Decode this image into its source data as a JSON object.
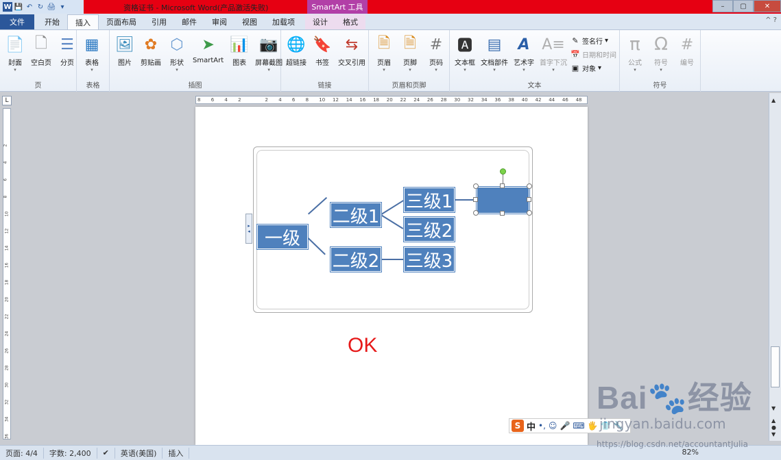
{
  "window": {
    "title": "资格证书 - Microsoft Word(产品激活失败)",
    "context_tab": "SmartArt 工具",
    "controls": {
      "minimize": "–",
      "maximize": "▢",
      "close": "✕"
    }
  },
  "quick_access": [
    "W",
    "💾",
    "↶",
    "↻",
    "🖨",
    "▾"
  ],
  "tabs": [
    {
      "label": "文件"
    },
    {
      "label": "开始"
    },
    {
      "label": "插入"
    },
    {
      "label": "页面布局"
    },
    {
      "label": "引用"
    },
    {
      "label": "邮件"
    },
    {
      "label": "审阅"
    },
    {
      "label": "视图"
    },
    {
      "label": "加载项"
    },
    {
      "label": "设计"
    },
    {
      "label": "格式"
    }
  ],
  "help": "^ ?",
  "ribbon": {
    "page_group": {
      "label": "页",
      "buttons": [
        "封面",
        "空白页",
        "分页"
      ]
    },
    "table_group": {
      "label": "表格",
      "buttons": [
        "表格"
      ]
    },
    "illust_group": {
      "label": "插图",
      "buttons": [
        "图片",
        "剪贴画",
        "形状",
        "SmartArt",
        "图表",
        "屏幕截图"
      ]
    },
    "link_group": {
      "label": "链接",
      "buttons": [
        "超链接",
        "书签",
        "交叉引用"
      ]
    },
    "hf_group": {
      "label": "页眉和页脚",
      "buttons": [
        "页眉",
        "页脚",
        "页码"
      ]
    },
    "text_group": {
      "label": "文本",
      "buttons": [
        "文本框",
        "文档部件",
        "艺术字",
        "首字下沉"
      ],
      "small": [
        "签名行",
        "日期和时间",
        "对象"
      ]
    },
    "symbol_group": {
      "label": "符号",
      "buttons": [
        "公式",
        "符号",
        "编号"
      ]
    }
  },
  "ruler_numbers": [
    "8",
    "6",
    "4",
    "2",
    "",
    "2",
    "4",
    "6",
    "8",
    "10",
    "12",
    "14",
    "16",
    "18",
    "20",
    "22",
    "24",
    "26",
    "28",
    "30",
    "32",
    "34",
    "36",
    "38",
    "40",
    "42",
    "44",
    "46",
    "48"
  ],
  "vruler_numbers": [
    "2",
    "4",
    "6",
    "8",
    "10",
    "12",
    "14",
    "16",
    "18",
    "20",
    "22",
    "24",
    "26",
    "28",
    "30",
    "32",
    "34",
    "36"
  ],
  "smartart": {
    "level1": "一级",
    "level2": [
      "二级1",
      "二级2"
    ],
    "level3": [
      "三级1",
      "三级2",
      "三级3"
    ],
    "new_box": ""
  },
  "annotation": "OK",
  "status": {
    "page": "页面: 4/4",
    "words": "字数: 2,400",
    "lang": "英语(美国)",
    "mode": "插入",
    "zoom": "82%"
  },
  "ime": {
    "logo": "S",
    "items": [
      "中",
      "•,",
      "☺",
      "🎤",
      "⌨",
      "🖐",
      "👕",
      "🔧"
    ]
  },
  "watermark": {
    "brand": "Bai",
    "brand_suffix": "经验",
    "site": "jingyan.baidu.com",
    "blog": "https://blog.csdn.net/accountantJulia"
  }
}
